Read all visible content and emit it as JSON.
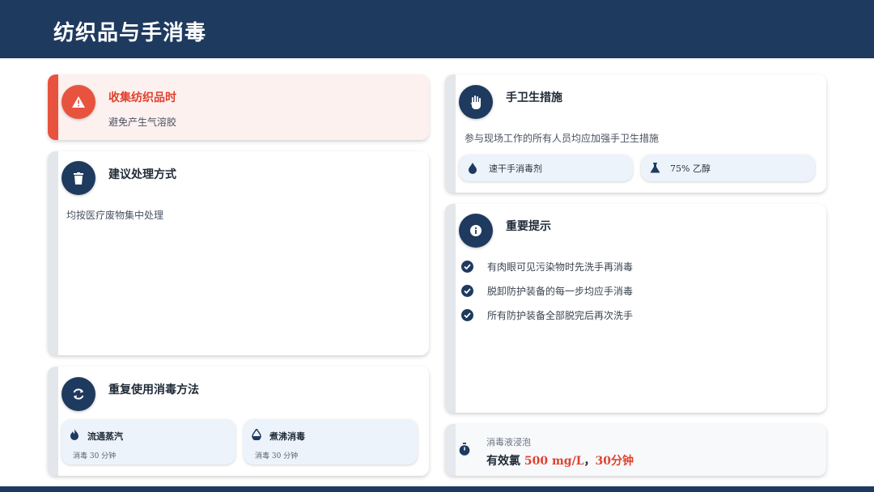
{
  "header": {
    "title": "纺织品与手消毒"
  },
  "colors": {
    "navy": "#1f3a5f",
    "red": "#e8533f",
    "light_blue": "#edf3fb",
    "warn_bg": "#fdf1ef"
  },
  "collect_card": {
    "title": "收集纺织品时",
    "text": "避免产生气溶胶",
    "icon": "warning-icon"
  },
  "disposal_card": {
    "title": "建议处理方式",
    "text": "均按医疗废物集中处理",
    "icon": "trash-icon"
  },
  "reuse_card": {
    "title": "重复使用消毒方法",
    "icon": "refresh-icon",
    "methods": [
      {
        "name": "流通蒸汽",
        "detail": "消毒 30 分钟",
        "icon": "fire-icon"
      },
      {
        "name": "煮沸消毒",
        "detail": "消毒 30 分钟",
        "icon": "droplet-half-icon"
      }
    ]
  },
  "hand_card": {
    "title": "手卫生措施",
    "text": "参与现场工作的所有人员均应加强手卫生措施",
    "icon": "hand-icon",
    "options": [
      {
        "label": "速干手消毒剂",
        "icon": "droplet-icon"
      },
      {
        "label": "75% 乙醇",
        "icon": "flask-icon"
      }
    ]
  },
  "tips_card": {
    "title": "重要提示",
    "icon": "info-icon",
    "items": [
      "有肉眼可见污染物时先洗手再消毒",
      "脱卸防护装备的每一步均应手消毒",
      "所有防护装备全部脱完后再次洗手"
    ]
  },
  "soak_card": {
    "label": "消毒液浸泡",
    "prefix": "有效氯",
    "concentration": "500 mg/L",
    "separator": "，",
    "duration": "30分钟",
    "icon": "stopwatch-icon"
  }
}
